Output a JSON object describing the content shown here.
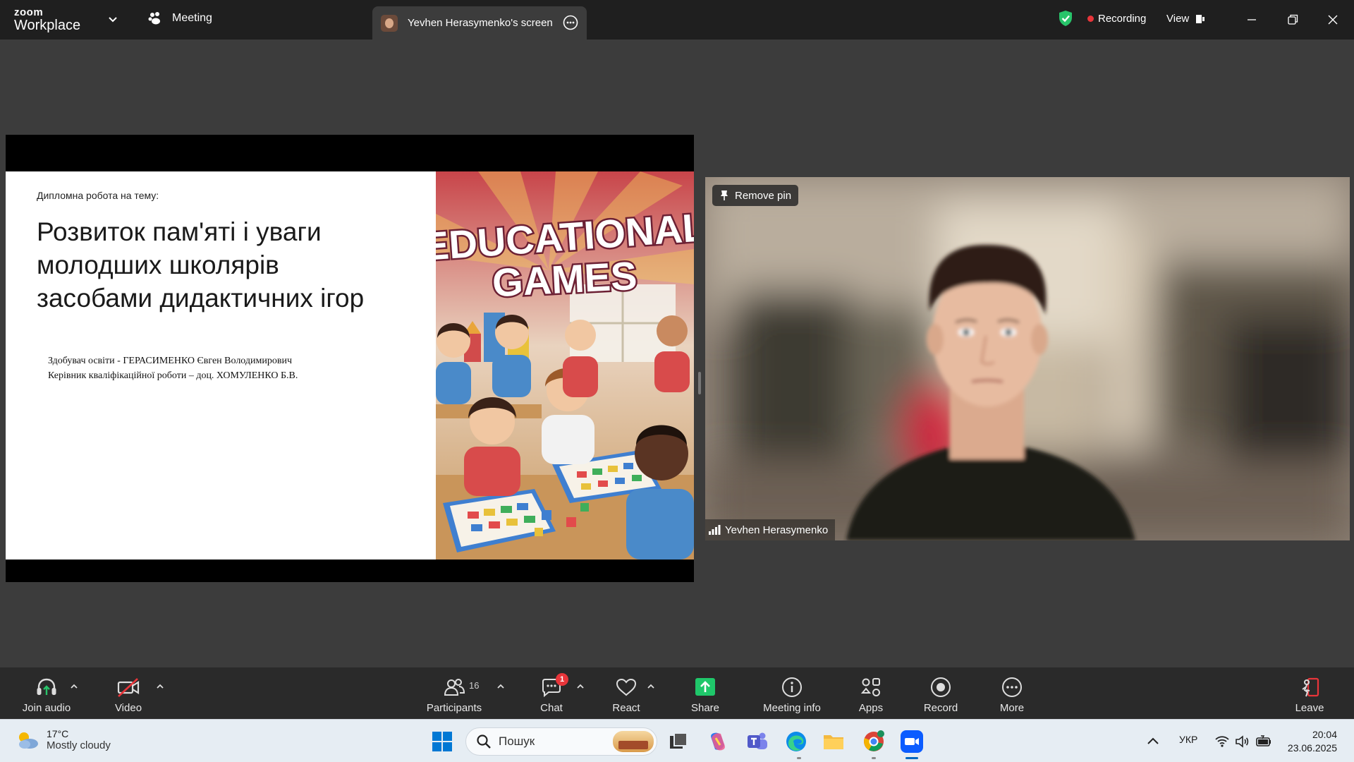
{
  "titlebar": {
    "logo_small": "zoom",
    "logo_large": "Workplace",
    "meeting_label": "Meeting",
    "tab_label": "Yevhen Herasymenko's screen",
    "recording_label": "Recording",
    "view_label": "View"
  },
  "slide": {
    "subtitle": "Дипломна робота на тему:",
    "title_lines": [
      "Розвиток пам'яті і уваги",
      "молодших школярів",
      "засобами дидактичних ігор"
    ],
    "author_line1": "Здобувач освіти - ГЕРАСИМЕНКО  Євген  Володимирович",
    "author_line2": "Керівник кваліфікаційної роботи – доц. ХОМУЛЕНКО Б.В.",
    "image_text_line1": "EDUCATIONAL",
    "image_text_line2": "GAMES"
  },
  "video": {
    "pin_label": "Remove pin",
    "participant_name": "Yevhen Herasymenko"
  },
  "toolbar": {
    "join_audio": "Join audio",
    "video": "Video",
    "participants": "Participants",
    "participants_count": "16",
    "chat": "Chat",
    "chat_badge": "1",
    "react": "React",
    "share": "Share",
    "meeting_info": "Meeting info",
    "apps": "Apps",
    "record": "Record",
    "more": "More",
    "leave": "Leave"
  },
  "taskbar": {
    "temperature": "17°C",
    "weather": "Mostly cloudy",
    "search_placeholder": "Пошук",
    "language": "УКР",
    "time": "20:04",
    "date": "23.06.2025"
  },
  "colors": {
    "titlebar_bg": "#1f1f1f",
    "stage_bg": "#3c3c3c",
    "recording_red": "#e8353a",
    "shield_green": "#28c46a",
    "share_green": "#1fc76a",
    "leave_red": "#e8353a"
  }
}
